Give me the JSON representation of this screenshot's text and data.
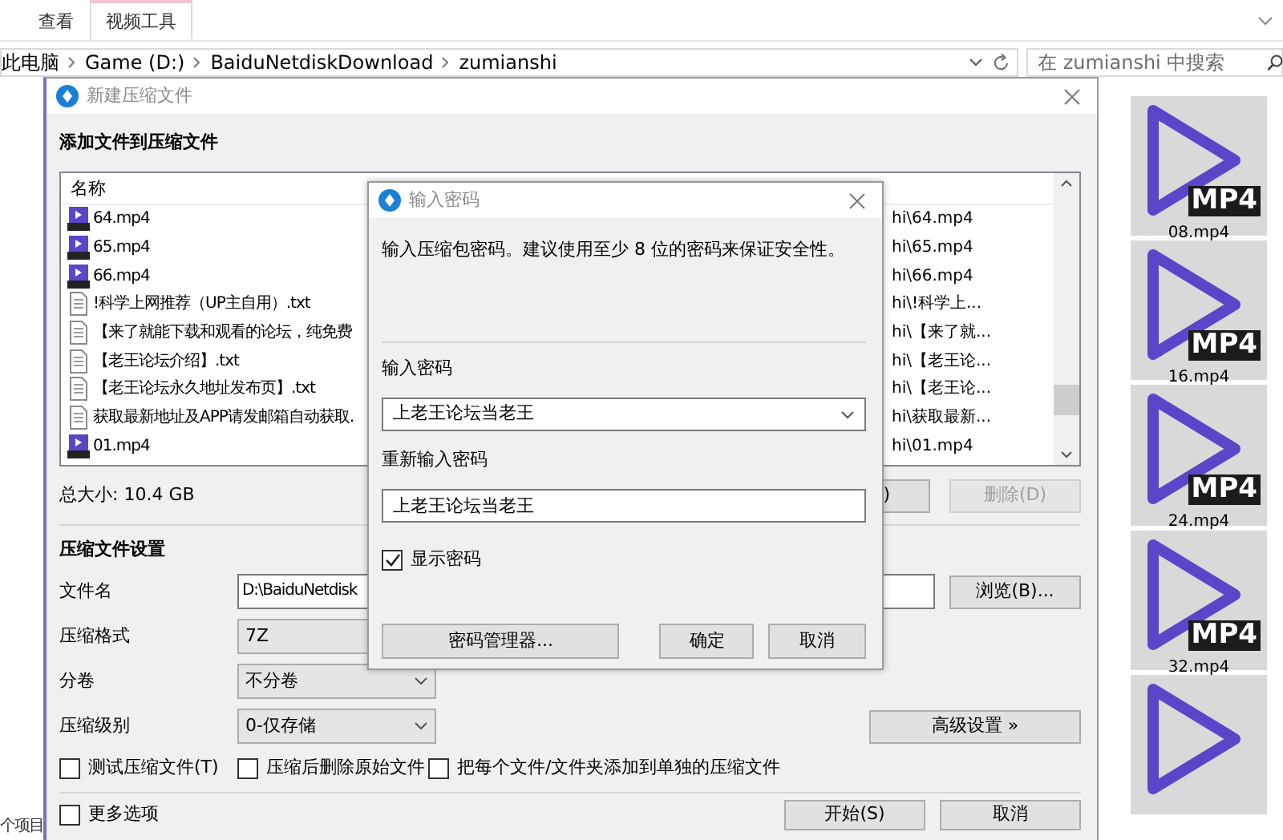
{
  "explorer": {
    "ribbon_tabs": [
      {
        "label": "查看",
        "selected": false
      },
      {
        "label": "视频工具",
        "selected": true
      }
    ],
    "breadcrumb": [
      "此电脑",
      "Game (D:)",
      "BaiduNetdiskDownload",
      "zumianshi"
    ],
    "search": {
      "placeholder": "在 zumianshi 中搜索"
    },
    "thumbnails": [
      {
        "kind": "video",
        "badge": "MP4",
        "label": "08.mp4"
      },
      {
        "kind": "video",
        "badge": "MP4",
        "label": "16.mp4"
      },
      {
        "kind": "video",
        "badge": "MP4",
        "label": "24.mp4"
      },
      {
        "kind": "video",
        "badge": "MP4",
        "label": "32.mp4"
      },
      {
        "kind": "partial"
      }
    ],
    "status_text": "个项目"
  },
  "archive_dialog": {
    "title": "新建压缩文件",
    "files_heading": "添加文件到压缩文件",
    "file_list": {
      "columns": [
        "名称"
      ],
      "rows": [
        {
          "kind": "video",
          "name": "64.mp4",
          "path": "hi\\64.mp4"
        },
        {
          "kind": "video",
          "name": "65.mp4",
          "path": "hi\\65.mp4"
        },
        {
          "kind": "video",
          "name": "66.mp4",
          "path": "hi\\66.mp4"
        },
        {
          "kind": "text",
          "name": "!科学上网推荐（UP主自用）.txt",
          "path": "hi\\!科学上..."
        },
        {
          "kind": "text",
          "name": "【来了就能下载和观看的论坛，纯免费",
          "path": "hi\\【来了就..."
        },
        {
          "kind": "text",
          "name": "【老王论坛介绍】.txt",
          "path": "hi\\【老王论..."
        },
        {
          "kind": "text",
          "name": "【老王论坛永久地址发布页】.txt",
          "path": "hi\\【老王论..."
        },
        {
          "kind": "text",
          "name": "获取最新地址及APP请发邮箱自动获取.",
          "path": "hi\\获取最新..."
        },
        {
          "kind": "video",
          "name": "01.mp4",
          "path": "hi\\01.mp4"
        }
      ]
    },
    "total_size": "总大小: 10.4 GB",
    "list_buttons": [
      {
        "label": ")",
        "disabled": false
      },
      {
        "label": "删除(D)",
        "disabled": true
      }
    ],
    "settings_heading": "压缩文件设置",
    "settings": [
      {
        "label": "文件名",
        "kind": "input",
        "value": "D:\\BaiduNetdisk",
        "button": "浏览(B)..."
      },
      {
        "label": "压缩格式",
        "kind": "select",
        "value": "7Z"
      },
      {
        "label": "分卷",
        "kind": "select",
        "value": "不分卷",
        "dropdown": true
      },
      {
        "label": "压缩级别",
        "kind": "select",
        "value": "0-仅存储",
        "dropdown": true,
        "button": "高级设置 »"
      }
    ],
    "options": [
      {
        "label": "测试压缩文件(T)",
        "checked": false
      },
      {
        "label": "压缩后删除原始文件",
        "checked": false
      },
      {
        "label": "把每个文件/文件夹添加到单独的压缩文件",
        "checked": false
      }
    ],
    "more_options": {
      "label": "更多选项",
      "checked": false
    },
    "buttons": [
      "开始(S)",
      "取消"
    ]
  },
  "password_dialog": {
    "title": "输入密码",
    "description": "输入压缩包密码。建议使用至少 8 位的密码来保证安全性。",
    "password_label": "输入密码",
    "password_value": "上老王论坛当老王",
    "confirm_label": "重新输入密码",
    "confirm_value": "上老王论坛当老王",
    "show_password": {
      "label": "显示密码",
      "checked": true
    },
    "buttons": [
      "密码管理器...",
      "确定",
      "取消"
    ]
  }
}
